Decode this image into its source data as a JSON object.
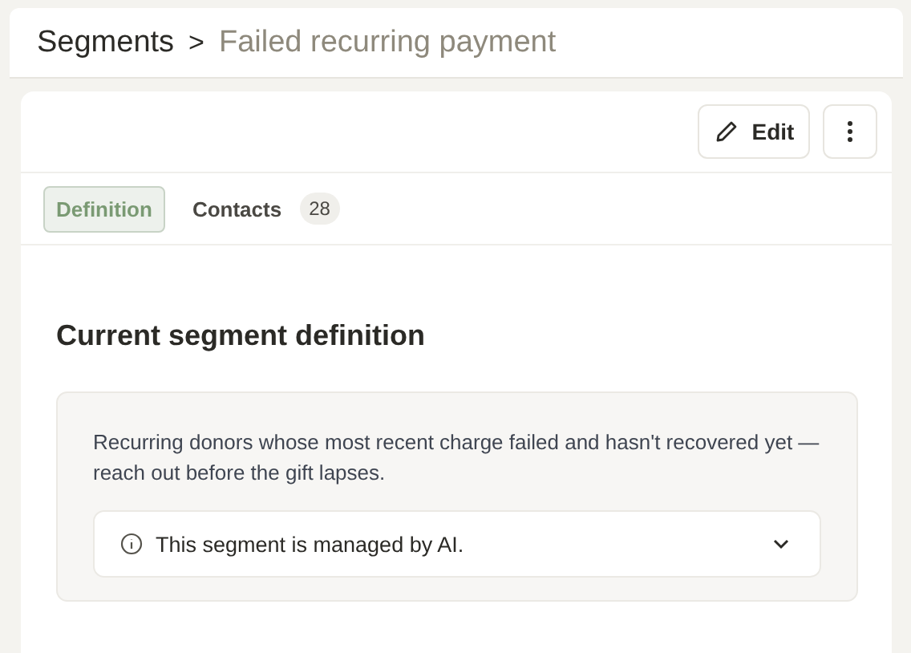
{
  "breadcrumb": {
    "parent": "Segments",
    "separator": ">",
    "current": "Failed recurring payment"
  },
  "toolbar": {
    "edit_label": "Edit"
  },
  "tabs": [
    {
      "label": "Definition",
      "selected": true
    },
    {
      "label": "Contacts",
      "selected": false,
      "count": "28"
    }
  ],
  "section": {
    "title": "Current segment definition",
    "description": "Recurring donors whose most recent charge failed and hasn't recovered yet — reach out before the gift lapses.",
    "notice": {
      "text": "This segment is managed by AI.",
      "expanded": false
    }
  }
}
